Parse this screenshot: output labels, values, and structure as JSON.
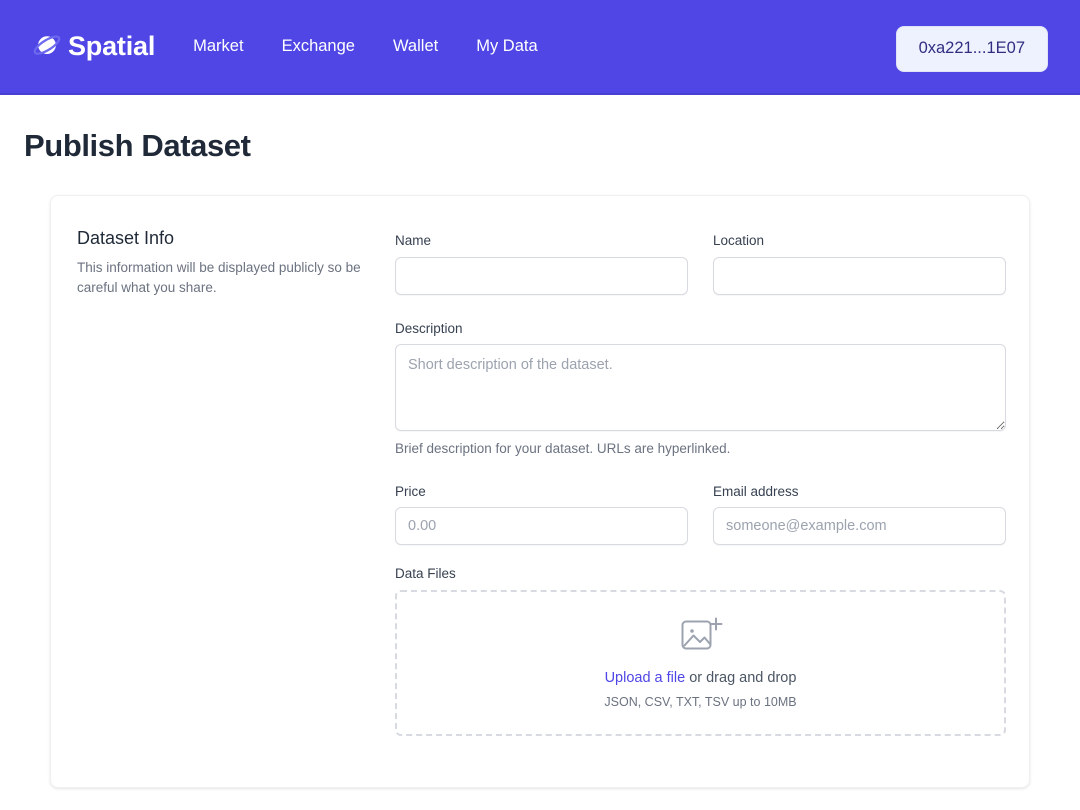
{
  "navbar": {
    "brand": {
      "name": "Spatial",
      "icon": "planet-icon"
    },
    "links": [
      {
        "label": "Market"
      },
      {
        "label": "Exchange"
      },
      {
        "label": "Wallet"
      },
      {
        "label": "My Data"
      }
    ],
    "wallet_button": {
      "label": "0xa221...1E07"
    },
    "background_color": "#4f46e5"
  },
  "page": {
    "title": "Publish Dataset"
  },
  "card": {
    "aside": {
      "title": "Dataset Info",
      "description": "This information will be displayed publicly so be careful what you share."
    },
    "fields": {
      "name": {
        "label": "Name",
        "value": "",
        "placeholder": ""
      },
      "location": {
        "label": "Location",
        "value": "",
        "placeholder": ""
      },
      "description": {
        "label": "Description",
        "value": "",
        "placeholder": "Short description of the dataset.",
        "hint": "Brief description for your dataset. URLs are hyperlinked."
      },
      "price": {
        "label": "Price",
        "value": "",
        "placeholder": "0.00"
      },
      "email": {
        "label": "Email address",
        "value": "",
        "placeholder": "someone@example.com"
      },
      "data_files": {
        "label": "Data Files",
        "icon": "image-plus-icon",
        "link_text": "Upload a file",
        "rest_text": " or drag and drop",
        "constraints": "JSON, CSV, TXT, TSV up to 10MB"
      }
    }
  },
  "colors": {
    "brand_purple": "#4f46e5",
    "link_indigo": "#4f46e5",
    "wallet_chip_bg": "#eef2ff",
    "border_gray": "#d7dae0",
    "text_dark": "#1f2937",
    "text_muted": "#6b7280"
  }
}
